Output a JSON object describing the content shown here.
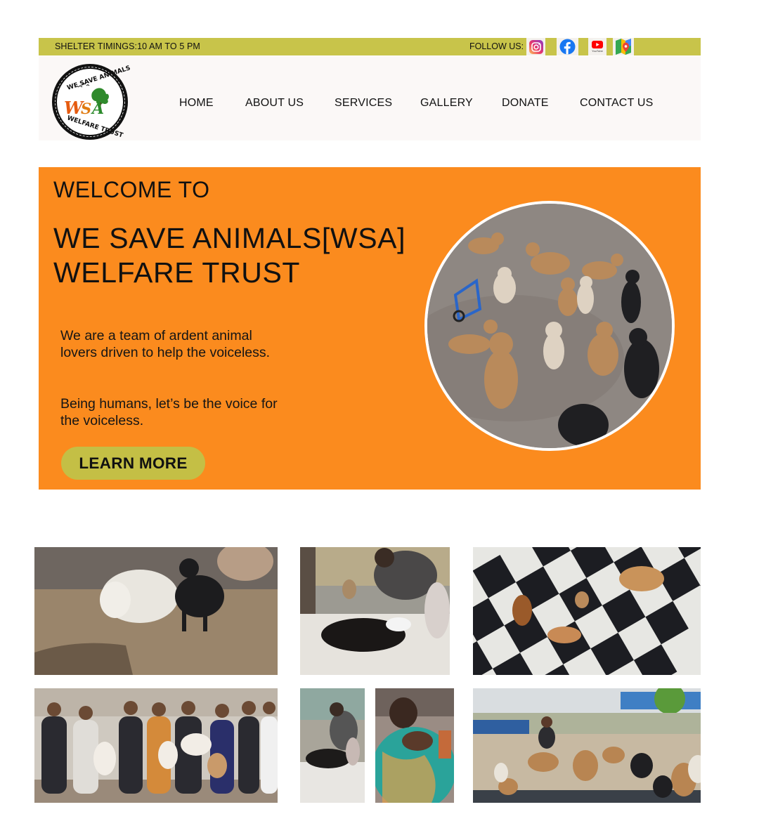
{
  "topbar": {
    "timings": "SHELTER TIMINGS:10 AM TO 5 PM",
    "follow_label": "FOLLOW US:",
    "social_icons": [
      "instagram-icon",
      "facebook-icon",
      "youtube-icon",
      "google-maps-icon"
    ],
    "youtube_caption": "YouTube"
  },
  "logo": {
    "top_text": "WE SAVE ANIMALS",
    "mark": "WSA",
    "bottom_text": "WELFARE TRUST"
  },
  "nav": [
    "HOME",
    "ABOUT US",
    "SERVICES",
    "GALLERY",
    "DONATE",
    "CONTACT US"
  ],
  "hero": {
    "welcome": "WELCOME TO",
    "org_line1": "WE SAVE ANIMALS[WSA]",
    "org_line2": "WELFARE TRUST",
    "paragraph1": "We are a team of ardent animal lovers driven to help the voiceless.",
    "paragraph2": "Being humans, let’s be the voice for the voiceless.",
    "cta": "LEARN MORE"
  },
  "colors": {
    "topbar": "#c8c44a",
    "hero_bg": "#fb8b1e",
    "cta_bg": "#c4bf45",
    "header_bg": "#fbf8f7"
  }
}
